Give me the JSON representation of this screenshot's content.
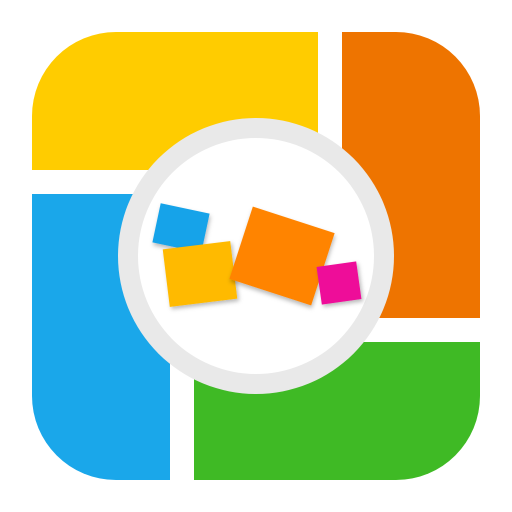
{
  "icon": {
    "name": "app-icon",
    "colors": {
      "yellow": "#FFCC00",
      "orange": "#EE7400",
      "blue": "#1AA7EA",
      "green": "#3FBA25",
      "ring": "#E9E9E9",
      "center_fill": "#FFFFFF",
      "square_blue": "#12A3E9",
      "square_yellow": "#FFBA00",
      "square_orange": "#FF8400",
      "square_magenta": "#EE0A99"
    }
  }
}
